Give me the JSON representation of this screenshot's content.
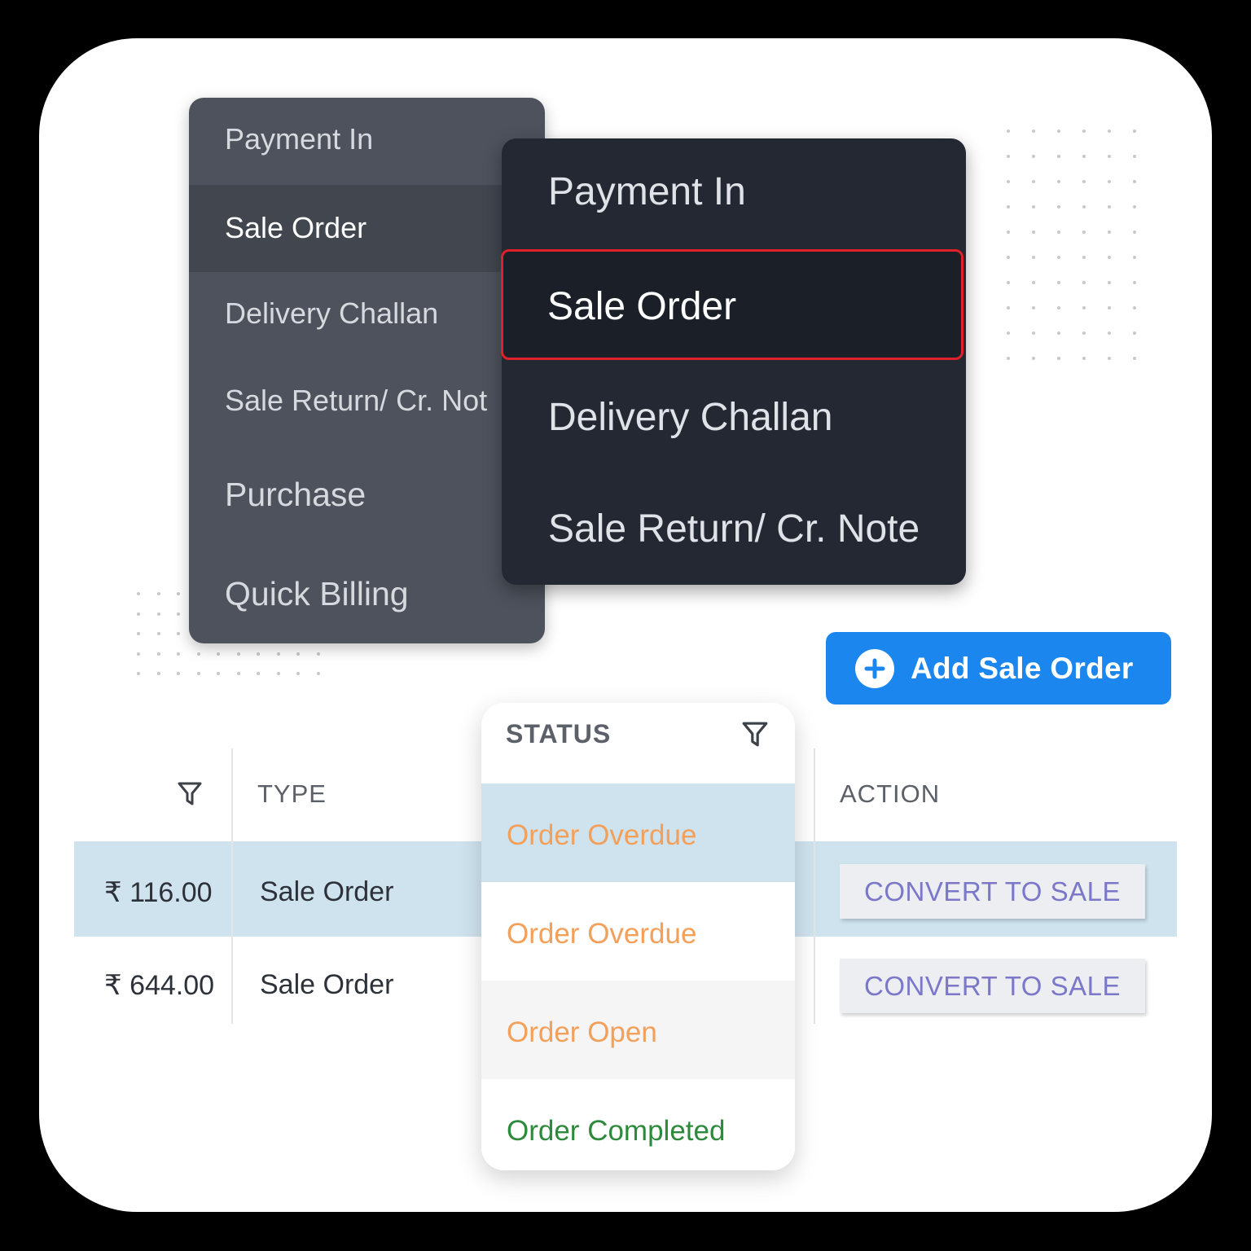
{
  "menu_back": {
    "items": [
      {
        "label": "Payment In"
      },
      {
        "label": "Sale Order"
      },
      {
        "label": "Delivery Challan"
      },
      {
        "label": "Sale Return/ Cr. Not"
      },
      {
        "label": "Purchase"
      },
      {
        "label": "Quick Billing"
      }
    ],
    "selected": "Sale Order"
  },
  "menu_front": {
    "items": [
      {
        "label": "Payment In"
      },
      {
        "label": "Sale Order"
      },
      {
        "label": "Delivery Challan"
      },
      {
        "label": "Sale Return/ Cr. Note"
      }
    ],
    "selected": "Sale Order"
  },
  "add_button": {
    "label": "Add Sale Order",
    "icon": "plus-circle-icon"
  },
  "table": {
    "columns": {
      "type": "TYPE",
      "action": "ACTION"
    },
    "rows": [
      {
        "amount": "₹ 116.00",
        "type": "Sale Order",
        "action": "CONVERT TO SALE"
      },
      {
        "amount": "₹ 644.00",
        "type": "Sale Order",
        "action": "CONVERT TO SALE"
      }
    ]
  },
  "status_filter": {
    "header": "STATUS",
    "options": [
      {
        "label": "Order Overdue",
        "color": "#f2a05a"
      },
      {
        "label": "Order Overdue",
        "color": "#f2a05a"
      },
      {
        "label": "Order Open",
        "color": "#f2a05a"
      },
      {
        "label": "Order Completed",
        "color": "#2c8a3a"
      }
    ]
  },
  "colors": {
    "accent": "#1c86ef",
    "highlight_border": "#e0212c",
    "row_highlight": "#cfe3ef"
  }
}
